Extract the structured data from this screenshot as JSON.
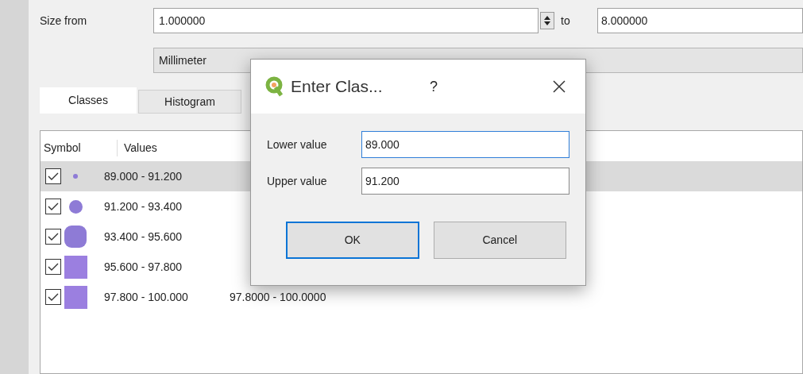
{
  "size_row": {
    "label": "Size from",
    "from_value": "1.000000",
    "to_label": "to",
    "to_value": "8.000000"
  },
  "unit": {
    "value": "Millimeter"
  },
  "tabs": [
    {
      "label": "Classes",
      "selected": true
    },
    {
      "label": "Histogram",
      "selected": false
    }
  ],
  "table": {
    "columns": [
      "Symbol",
      "Values"
    ],
    "rows": [
      {
        "checked": true,
        "selected": true,
        "symbol": {
          "kind": "tiny",
          "color": "#8e7bd6"
        },
        "values": "89.000 - 91.200"
      },
      {
        "checked": true,
        "selected": false,
        "symbol": {
          "kind": "circle",
          "color": "#8e7bd6"
        },
        "values": "91.200 - 93.400"
      },
      {
        "checked": true,
        "selected": false,
        "symbol": {
          "kind": "large",
          "color": "#8e7bd6"
        },
        "values": "93.400 - 95.600"
      },
      {
        "checked": true,
        "selected": false,
        "symbol": {
          "kind": "square",
          "color": "#9b7fe0"
        },
        "values": "95.600 - 97.800"
      },
      {
        "checked": true,
        "selected": false,
        "symbol": {
          "kind": "square",
          "color": "#9b7fe0"
        },
        "values": "97.800 - 100.000",
        "legend": "97.8000 - 100.0000"
      }
    ]
  },
  "dialog": {
    "title": "Enter Clas...",
    "help": "?",
    "fields": [
      {
        "label": "Lower value",
        "value": "89.000",
        "focused": true
      },
      {
        "label": "Upper value",
        "value": "91.200",
        "focused": false
      }
    ],
    "buttons": [
      {
        "label": "OK",
        "default": true
      },
      {
        "label": "Cancel",
        "default": false
      }
    ]
  }
}
